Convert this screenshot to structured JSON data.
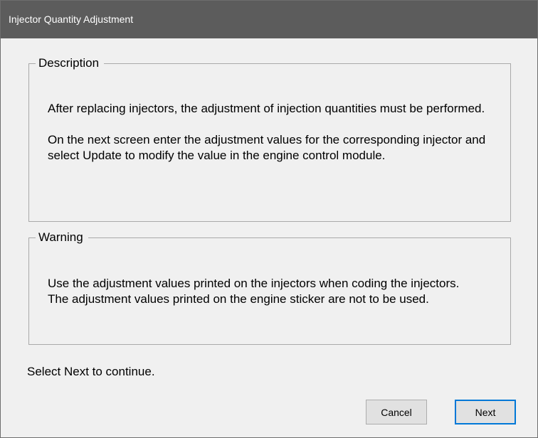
{
  "window": {
    "title": "Injector Quantity Adjustment"
  },
  "description": {
    "legend": "Description",
    "paragraphs": [
      "After replacing injectors, the adjustment of injection quantities must be performed.",
      "On the next screen enter the adjustment values for the corresponding injector and select Update to modify the value in the engine control module."
    ]
  },
  "warning": {
    "legend": "Warning",
    "paragraphs": [
      "Use the adjustment values printed on the injectors when coding the injectors.  The adjustment values printed on the engine sticker are not to be used."
    ]
  },
  "footer": {
    "instruction": "Select Next to continue."
  },
  "buttons": {
    "cancel": "Cancel",
    "next": "Next"
  },
  "colors": {
    "titlebar": "#5c5c5c",
    "window_background": "#f0f0f0",
    "default_button_border": "#0078d7"
  }
}
